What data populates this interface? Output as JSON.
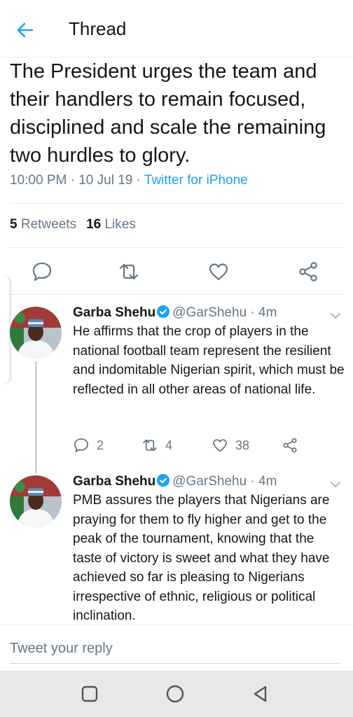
{
  "header": {
    "title": "Thread",
    "back_icon": "arrow-left-icon"
  },
  "tweet": {
    "text": "The President urges the team and their handlers to remain focused, disciplined and scale the remaining two hurdles to glory.",
    "time": "10:00 PM",
    "sep1": " · ",
    "date": "10 Jul 19",
    "sep2": " · ",
    "source": "Twitter for iPhone",
    "retweets_count": "5",
    "retweets_label": " Retweets",
    "likes_count": "16",
    "likes_label": " Likes"
  },
  "actions": {
    "reply_icon": "reply-icon",
    "retweet_icon": "retweet-icon",
    "like_icon": "heart-icon",
    "share_icon": "share-icon"
  },
  "replies": [
    {
      "name": "Garba Shehu",
      "handle": "@GarShehu",
      "sep": " · ",
      "time": "4m",
      "text": "He affirms that the crop of players in the national football team represent the resilient and indomitable Nigerian spirit, which must be reflected in all other areas of national life.",
      "reply_count": "2",
      "retweet_count": "4",
      "like_count": "38"
    },
    {
      "name": "Garba Shehu",
      "handle": "@GarShehu",
      "sep": " · ",
      "time": "4m",
      "text": "PMB assures the players that Nigerians are praying for them to fly higher and get to the peak of the tournament, knowing that the taste of victory is sweet and what they have achieved so far is pleasing to Nigerians irrespective of ethnic, religious or political inclination."
    }
  ],
  "composer": {
    "placeholder": "Tweet your reply"
  },
  "navbar": {
    "items": [
      "square-icon",
      "circle-icon",
      "back-triangle-icon"
    ]
  },
  "colors": {
    "accent": "#1da1f2",
    "text": "#14171a",
    "muted": "#657786",
    "verified": "#1da1f2"
  }
}
